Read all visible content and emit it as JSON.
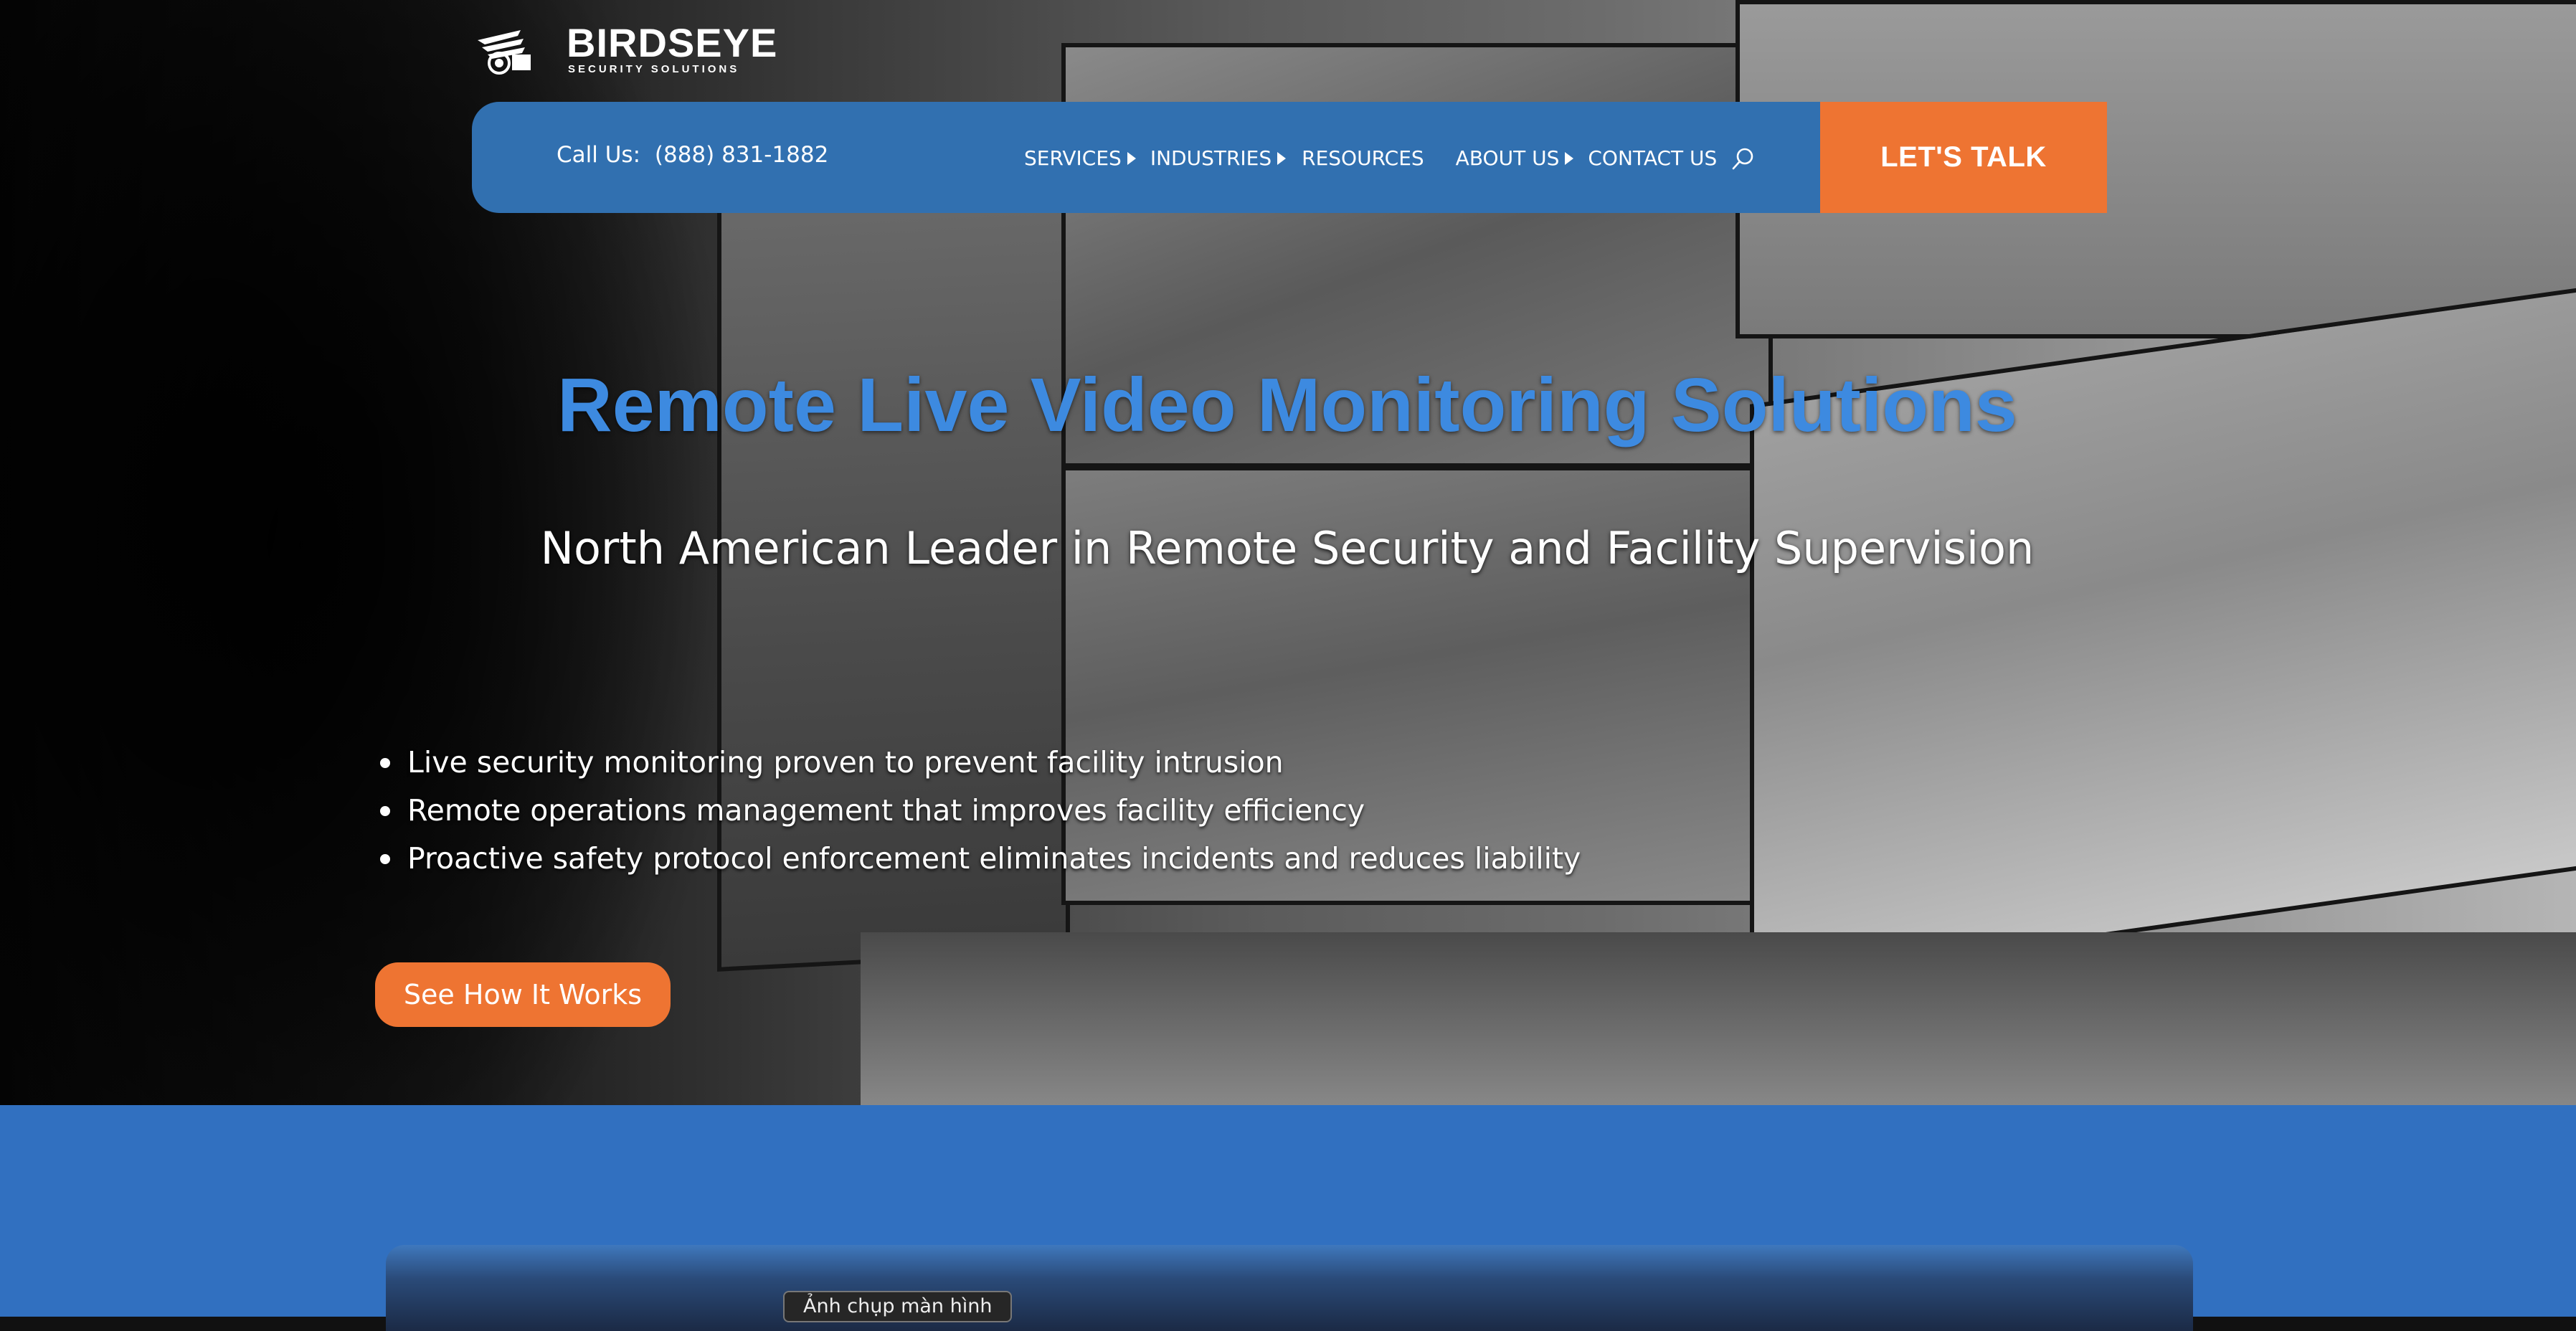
{
  "brand": {
    "name": "BIRDSEYE",
    "tagline": "SECURITY SOLUTIONS"
  },
  "header": {
    "call_label": "Call Us:",
    "phone": "(888) 831-1882",
    "nav": [
      {
        "label": "SERVICES",
        "has_submenu": true
      },
      {
        "label": "INDUSTRIES",
        "has_submenu": true
      },
      {
        "label": "RESOURCES",
        "has_submenu": false
      },
      {
        "label": "ABOUT US",
        "has_submenu": true
      },
      {
        "label": "CONTACT US",
        "has_submenu": false
      }
    ],
    "search_icon": "search-icon",
    "cta_label": "LET'S TALK"
  },
  "hero": {
    "headline": "Remote Live Video Monitoring Solutions",
    "subheadline": "North American Leader in Remote Security and Facility Supervision",
    "bullets": [
      "Live security monitoring proven to prevent facility intrusion",
      "Remote operations management that improves facility efficiency",
      "Proactive safety protocol enforcement eliminates incidents and reduces liability"
    ],
    "button_label": "See How It Works"
  },
  "overlay": {
    "screenshot_label": "Ảnh chụp màn hình"
  },
  "colors": {
    "nav_blue": "#3170b0",
    "accent_orange": "#ee7432",
    "headline_blue": "#3d8ae0",
    "section_blue": "#3170c0"
  }
}
